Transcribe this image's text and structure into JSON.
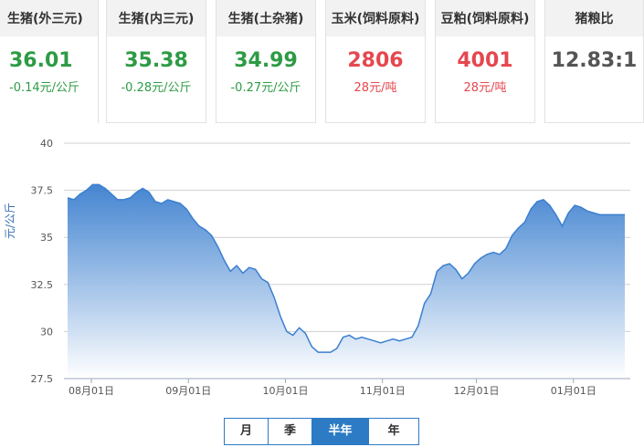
{
  "cards": [
    {
      "title": "生猪(外三元)",
      "price": "36.01",
      "change": "-0.14元/公斤",
      "color": "green"
    },
    {
      "title": "生猪(内三元)",
      "price": "35.38",
      "change": "-0.28元/公斤",
      "color": "green"
    },
    {
      "title": "生猪(土杂猪)",
      "price": "34.99",
      "change": "-0.27元/公斤",
      "color": "green"
    },
    {
      "title": "玉米(饲料原料)",
      "price": "2806",
      "change": "28元/吨",
      "color": "red"
    },
    {
      "title": "豆粕(饲料原料)",
      "price": "4001",
      "change": "28元/吨",
      "color": "red"
    },
    {
      "title": "猪粮比",
      "price": "12.83:1",
      "change": "",
      "color": "gray"
    }
  ],
  "range_buttons": [
    {
      "label": "月",
      "active": false
    },
    {
      "label": "季",
      "active": false
    },
    {
      "label": "半年",
      "active": true
    },
    {
      "label": "年",
      "active": false
    }
  ],
  "colors": {
    "line": "#3b7fcf",
    "fill_top": "#3b7fcf",
    "fill_bottom": "#ffffff",
    "grid": "#d0d0d0"
  },
  "chart_data": {
    "type": "area",
    "ylabel": "元/公斤",
    "ylim": [
      27.5,
      40
    ],
    "yticks": [
      "40",
      "37.5",
      "35",
      "32.5",
      "30",
      "27.5"
    ],
    "xticks": [
      "08月01日",
      "09月01日",
      "10月01日",
      "11月01日",
      "12月01日",
      "01月01日"
    ],
    "grid": true,
    "x": [
      0,
      2,
      4,
      6,
      8,
      10,
      12,
      14,
      16,
      18,
      20,
      22,
      24,
      26,
      28,
      30,
      32,
      34,
      36,
      38,
      40,
      42,
      44,
      46,
      48,
      50,
      52,
      54,
      56,
      58,
      60,
      62,
      64,
      66,
      68,
      70,
      72,
      74,
      76,
      78,
      80,
      82,
      84,
      86,
      88,
      90,
      92,
      94,
      96,
      98,
      100,
      102,
      104,
      106,
      108,
      110,
      112,
      114,
      116,
      118,
      120,
      122,
      124,
      126,
      128,
      130,
      132,
      134,
      136,
      138,
      140,
      142,
      144,
      146,
      148,
      150,
      152,
      154,
      156,
      158,
      160,
      162,
      164,
      166,
      168,
      170,
      172,
      174,
      176,
      178
    ],
    "values": [
      37.1,
      37.0,
      37.3,
      37.5,
      37.8,
      37.8,
      37.6,
      37.3,
      37.0,
      37.0,
      37.1,
      37.4,
      37.6,
      37.4,
      36.9,
      36.8,
      37.0,
      36.9,
      36.8,
      36.5,
      36.0,
      35.6,
      35.4,
      35.1,
      34.5,
      33.8,
      33.2,
      33.5,
      33.1,
      33.4,
      33.3,
      32.8,
      32.6,
      31.8,
      30.8,
      30.0,
      29.8,
      30.2,
      29.9,
      29.2,
      28.9,
      28.9,
      28.9,
      29.1,
      29.7,
      29.8,
      29.6,
      29.7,
      29.6,
      29.5,
      29.4,
      29.5,
      29.6,
      29.5,
      29.6,
      29.7,
      30.3,
      31.5,
      32.0,
      33.2,
      33.5,
      33.6,
      33.3,
      32.8,
      33.1,
      33.6,
      33.9,
      34.1,
      34.2,
      34.1,
      34.4,
      35.1,
      35.5,
      35.8,
      36.5,
      36.9,
      37.0,
      36.7,
      36.2,
      35.6,
      36.3,
      36.7,
      36.6,
      36.4,
      36.3,
      36.2,
      36.2,
      36.2,
      36.2,
      36.2
    ],
    "xtick_positions": [
      0,
      31,
      62,
      93,
      123,
      154
    ]
  }
}
